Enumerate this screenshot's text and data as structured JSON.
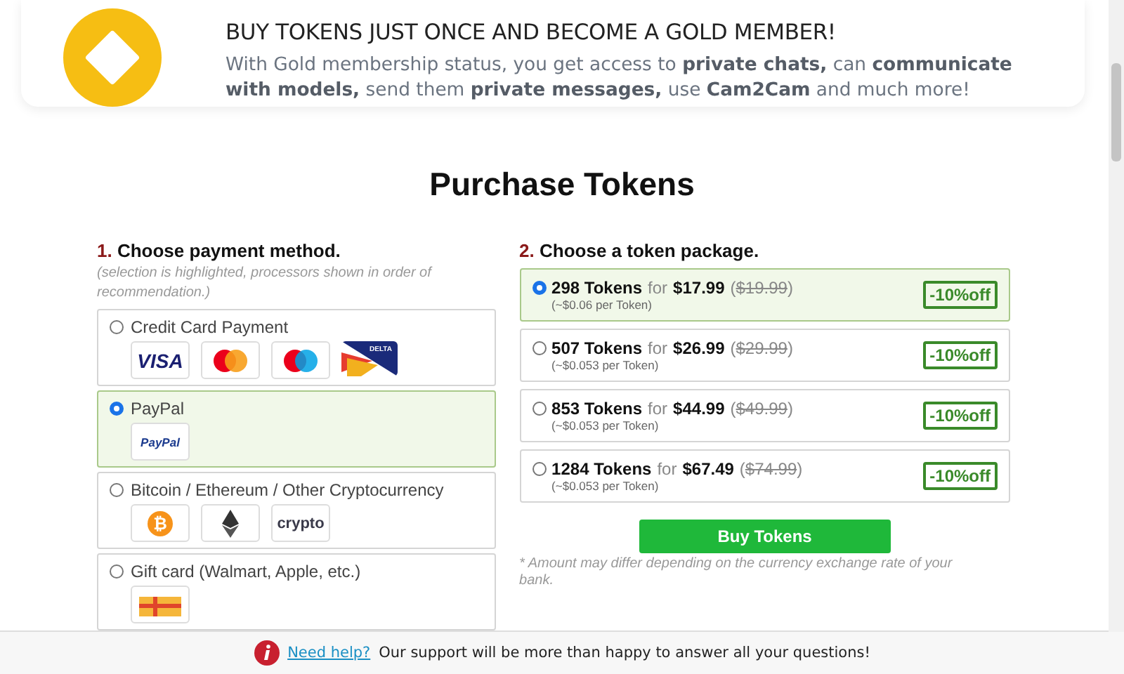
{
  "banner": {
    "title": "BUY TOKENS JUST ONCE AND BECOME A GOLD MEMBER!",
    "body": "With Gold membership status, you get access to **private chats,** can **communicate with models,** send them **private messages,** use **Cam2Cam** and much more!"
  },
  "heading": "Purchase Tokens",
  "payment": {
    "step": "1.",
    "title": "Choose payment method.",
    "note": "(selection is highlighted, processors shown in order of recommendation.)",
    "methods": [
      {
        "label": "Credit Card Payment",
        "selected": false,
        "logos": [
          {
            "kind": "visa",
            "text": "VISA"
          },
          {
            "kind": "mastercard"
          },
          {
            "kind": "maestro"
          },
          {
            "kind": "delta",
            "text": "DELTA"
          }
        ]
      },
      {
        "label": "PayPal",
        "selected": true,
        "logos": [
          {
            "kind": "paypal",
            "text": "PayPal"
          }
        ]
      },
      {
        "label": "Bitcoin / Ethereum / Other Cryptocurrency",
        "selected": false,
        "logos": [
          {
            "kind": "bitcoin",
            "text": "₿"
          },
          {
            "kind": "ethereum"
          },
          {
            "kind": "crypto",
            "text": "crypto"
          }
        ]
      },
      {
        "label": "Gift card (Walmart, Apple, etc.)",
        "selected": false,
        "logos": [
          {
            "kind": "giftcard"
          }
        ]
      }
    ]
  },
  "packages": {
    "step": "2.",
    "title": "Choose a token package.",
    "items": [
      {
        "tokens": "298 Tokens",
        "for": "for",
        "price": "$17.99",
        "open": "(",
        "old_price": "$19.99",
        "close": ")",
        "per": "(~$0.06 per Token)",
        "discount": "-10%off",
        "selected": true
      },
      {
        "tokens": "507 Tokens",
        "for": "for",
        "price": "$26.99",
        "open": "(",
        "old_price": "$29.99",
        "close": ")",
        "per": "(~$0.053 per Token)",
        "discount": "-10%off",
        "selected": false
      },
      {
        "tokens": "853 Tokens",
        "for": "for",
        "price": "$44.99",
        "open": "(",
        "old_price": "$49.99",
        "close": ")",
        "per": "(~$0.053 per Token)",
        "discount": "-10%off",
        "selected": false
      },
      {
        "tokens": "1284 Tokens",
        "for": "for",
        "price": "$67.49",
        "open": "(",
        "old_price": "$74.99",
        "close": ")",
        "per": "(~$0.053 per Token)",
        "discount": "-10%off",
        "selected": false
      }
    ],
    "button": "Buy Tokens",
    "note": "* Amount may differ depending on the currency exchange rate of your bank."
  },
  "footer": {
    "link": "Need help?",
    "text": "Our support will be more than happy to answer all your questions!"
  }
}
